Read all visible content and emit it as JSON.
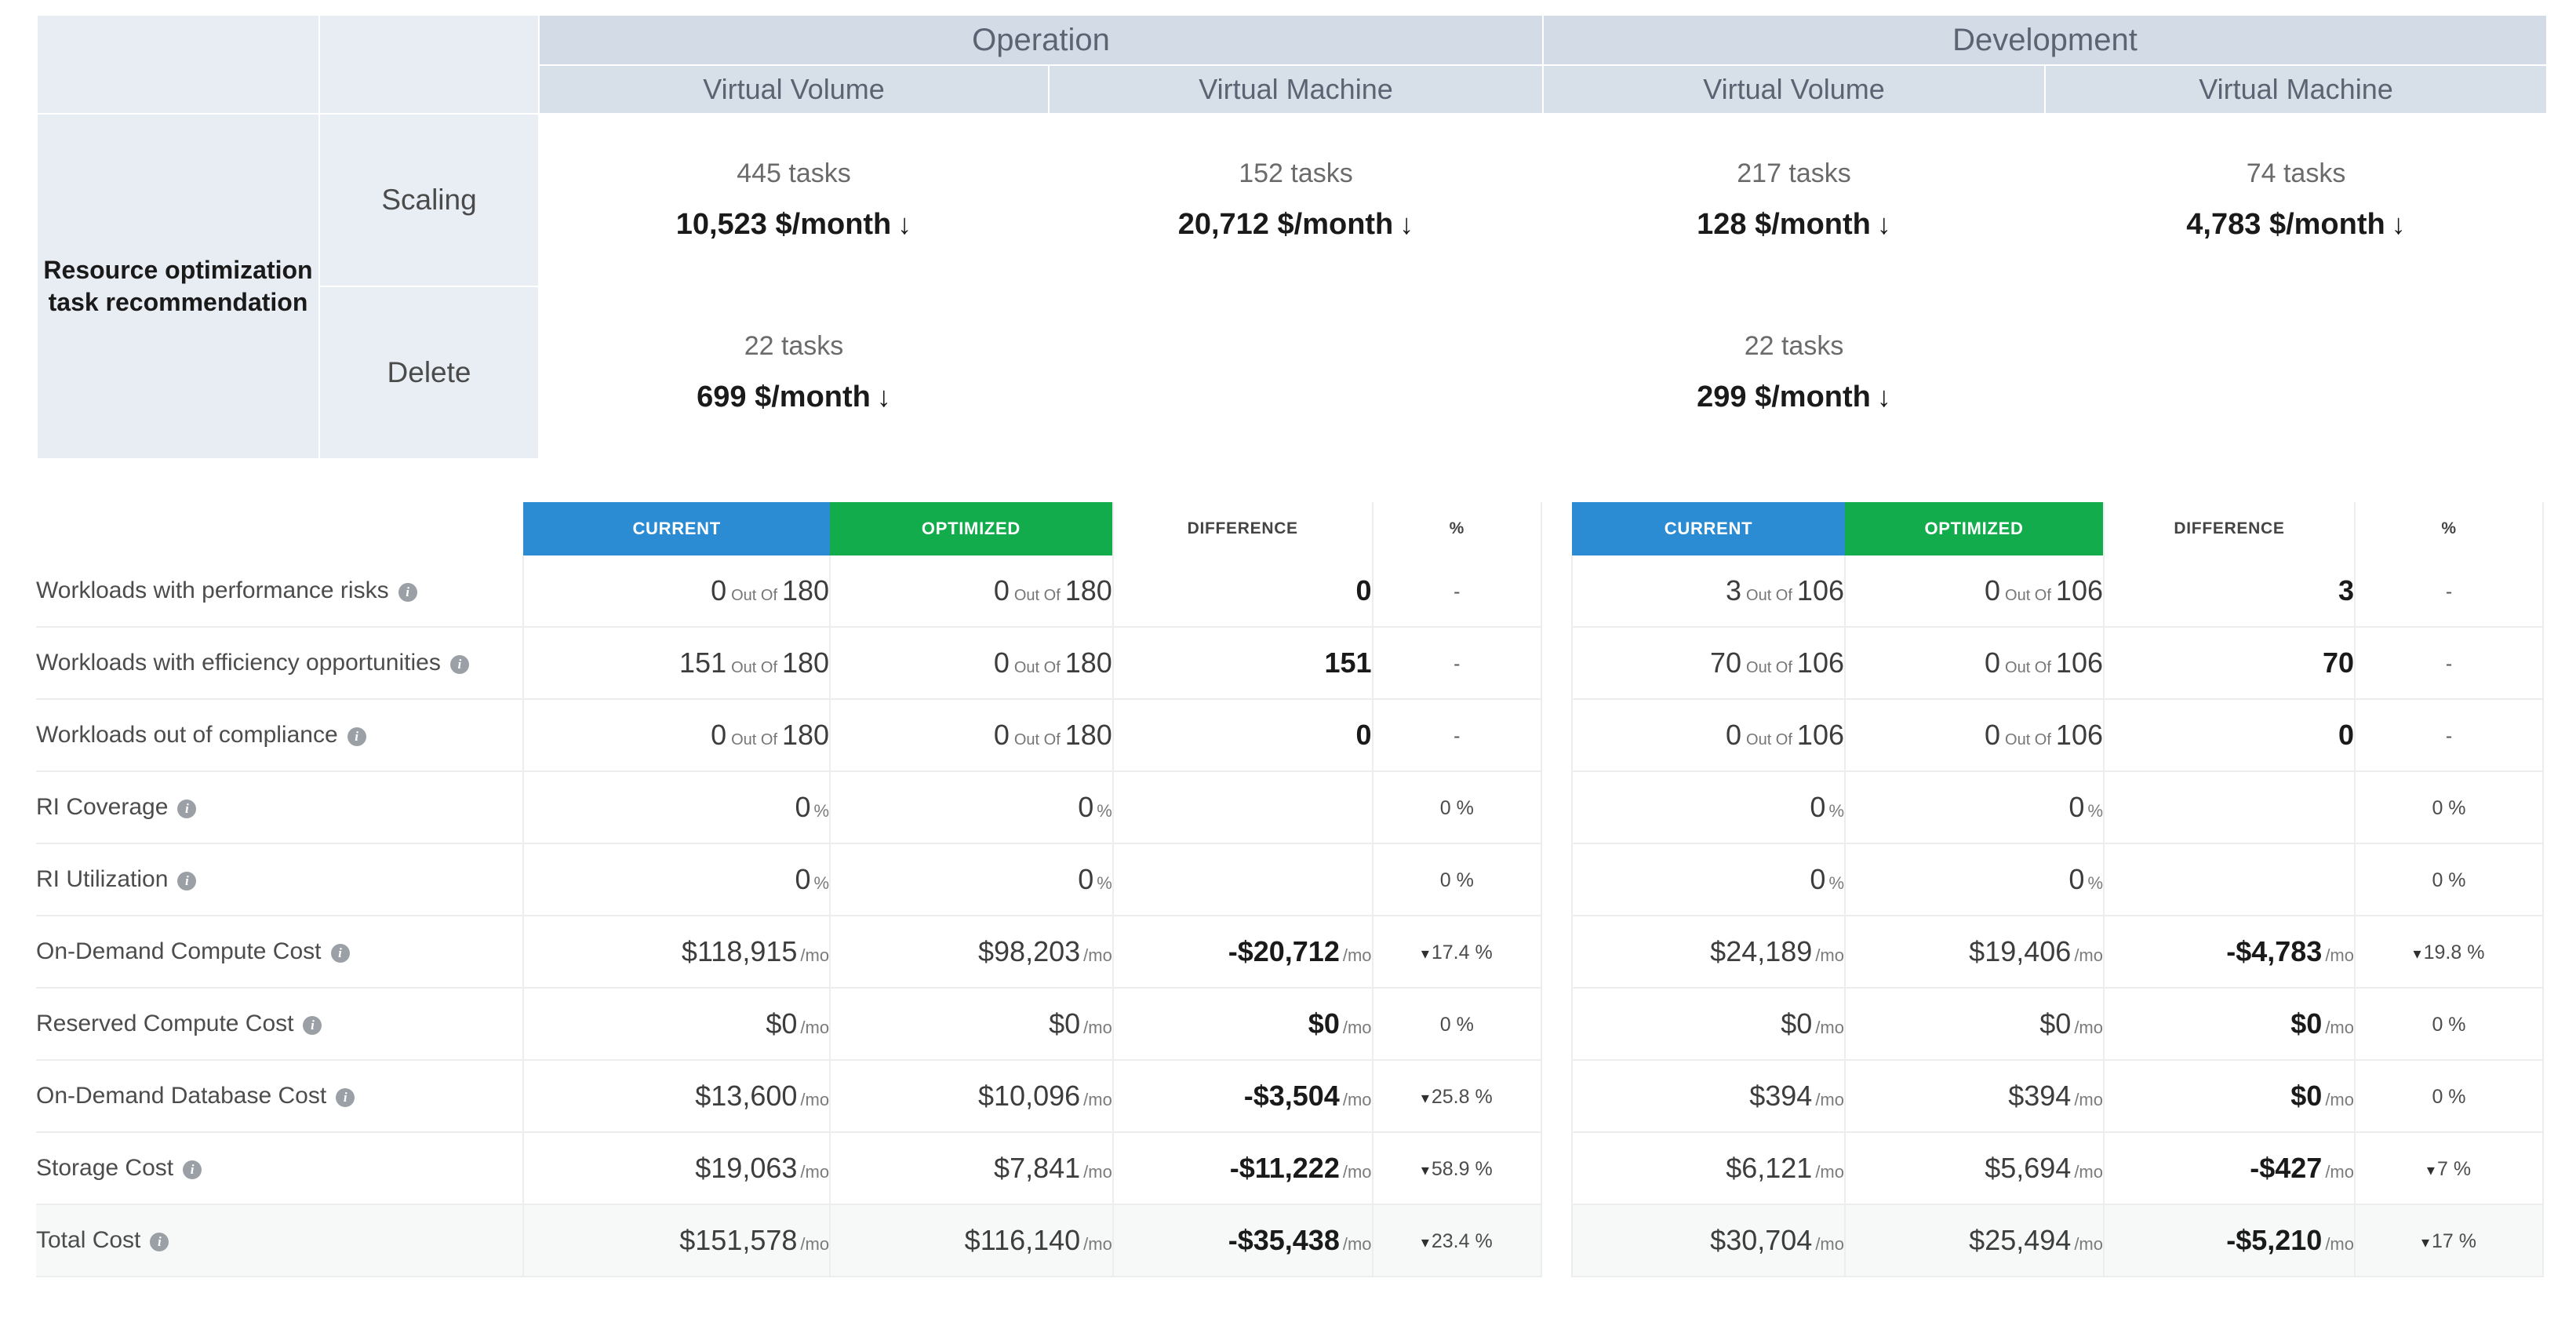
{
  "top_table": {
    "row_header": "Resource optimization task recommendation",
    "groups": [
      {
        "label": "Operation",
        "subcolumns": [
          "Virtual Volume",
          "Virtual Machine"
        ]
      },
      {
        "label": "Development",
        "subcolumns": [
          "Virtual Volume",
          "Virtual Machine"
        ]
      }
    ],
    "arrow_glyph": "↓",
    "rows": [
      {
        "label": "Scaling",
        "cells": [
          {
            "tasks": "445 tasks",
            "money": "10,523 $/month"
          },
          {
            "tasks": "152 tasks",
            "money": "20,712 $/month"
          },
          {
            "tasks": "217 tasks",
            "money": "128 $/month"
          },
          {
            "tasks": "74 tasks",
            "money": "4,783 $/month"
          }
        ]
      },
      {
        "label": "Delete",
        "cells": [
          {
            "tasks": "22 tasks",
            "money": "699 $/month"
          },
          {
            "tasks": "",
            "money": ""
          },
          {
            "tasks": "22 tasks",
            "money": "299 $/month"
          },
          {
            "tasks": "",
            "money": ""
          }
        ]
      }
    ]
  },
  "comparison": {
    "headers": {
      "current": "CURRENT",
      "optimized": "OPTIMIZED",
      "difference": "DIFFERENCE",
      "percent": "%"
    },
    "out_of_label": "Out Of",
    "unit_month": "/mo",
    "unit_percent": "%",
    "caret_down": "▾",
    "dash": "-",
    "row_labels": [
      "Workloads with performance risks",
      "Workloads with efficiency opportunities",
      "Workloads out of compliance",
      "RI Coverage",
      "RI Utilization",
      "On-Demand Compute Cost",
      "Reserved Compute Cost",
      "On-Demand Database Cost",
      "Storage Cost",
      "Total Cost"
    ],
    "info_glyph": "i",
    "left": {
      "rows": [
        {
          "kind": "ratio",
          "current": "0",
          "current_total": "180",
          "optimized": "0",
          "optimized_total": "180",
          "difference": "0",
          "percent": "-"
        },
        {
          "kind": "ratio",
          "current": "151",
          "current_total": "180",
          "optimized": "0",
          "optimized_total": "180",
          "difference": "151",
          "percent": "-"
        },
        {
          "kind": "ratio",
          "current": "0",
          "current_total": "180",
          "optimized": "0",
          "optimized_total": "180",
          "difference": "0",
          "percent": "-"
        },
        {
          "kind": "percent",
          "current": "0",
          "optimized": "0",
          "difference": "",
          "percent": "0 %"
        },
        {
          "kind": "percent",
          "current": "0",
          "optimized": "0",
          "difference": "",
          "percent": "0 %"
        },
        {
          "kind": "money",
          "current": "$118,915",
          "optimized": "$98,203",
          "difference": "-$20,712",
          "percent": "17.4 %",
          "trend": "down"
        },
        {
          "kind": "money",
          "current": "$0",
          "optimized": "$0",
          "difference": "$0",
          "percent": "0 %",
          "trend": "none"
        },
        {
          "kind": "money",
          "current": "$13,600",
          "optimized": "$10,096",
          "difference": "-$3,504",
          "percent": "25.8 %",
          "trend": "down"
        },
        {
          "kind": "money",
          "current": "$19,063",
          "optimized": "$7,841",
          "difference": "-$11,222",
          "percent": "58.9 %",
          "trend": "down"
        },
        {
          "kind": "money",
          "current": "$151,578",
          "optimized": "$116,140",
          "difference": "-$35,438",
          "percent": "23.4 %",
          "trend": "down"
        }
      ]
    },
    "right": {
      "rows": [
        {
          "kind": "ratio",
          "current": "3",
          "current_total": "106",
          "optimized": "0",
          "optimized_total": "106",
          "difference": "3",
          "percent": "-"
        },
        {
          "kind": "ratio",
          "current": "70",
          "current_total": "106",
          "optimized": "0",
          "optimized_total": "106",
          "difference": "70",
          "percent": "-"
        },
        {
          "kind": "ratio",
          "current": "0",
          "current_total": "106",
          "optimized": "0",
          "optimized_total": "106",
          "difference": "0",
          "percent": "-"
        },
        {
          "kind": "percent",
          "current": "0",
          "optimized": "0",
          "difference": "",
          "percent": "0 %"
        },
        {
          "kind": "percent",
          "current": "0",
          "optimized": "0",
          "difference": "",
          "percent": "0 %"
        },
        {
          "kind": "money",
          "current": "$24,189",
          "optimized": "$19,406",
          "difference": "-$4,783",
          "percent": "19.8 %",
          "trend": "down"
        },
        {
          "kind": "money",
          "current": "$0",
          "optimized": "$0",
          "difference": "$0",
          "percent": "0 %",
          "trend": "none"
        },
        {
          "kind": "money",
          "current": "$394",
          "optimized": "$394",
          "difference": "$0",
          "percent": "0 %",
          "trend": "none"
        },
        {
          "kind": "money",
          "current": "$6,121",
          "optimized": "$5,694",
          "difference": "-$427",
          "percent": "7 %",
          "trend": "down"
        },
        {
          "kind": "money",
          "current": "$30,704",
          "optimized": "$25,494",
          "difference": "-$5,210",
          "percent": "17 %",
          "trend": "down"
        }
      ]
    }
  },
  "colors": {
    "current_header": "#2b8cd3",
    "optimized_header": "#13ac4c",
    "group_header_bg": "#d3dce6",
    "row_header_bg": "#e8ecf3"
  }
}
